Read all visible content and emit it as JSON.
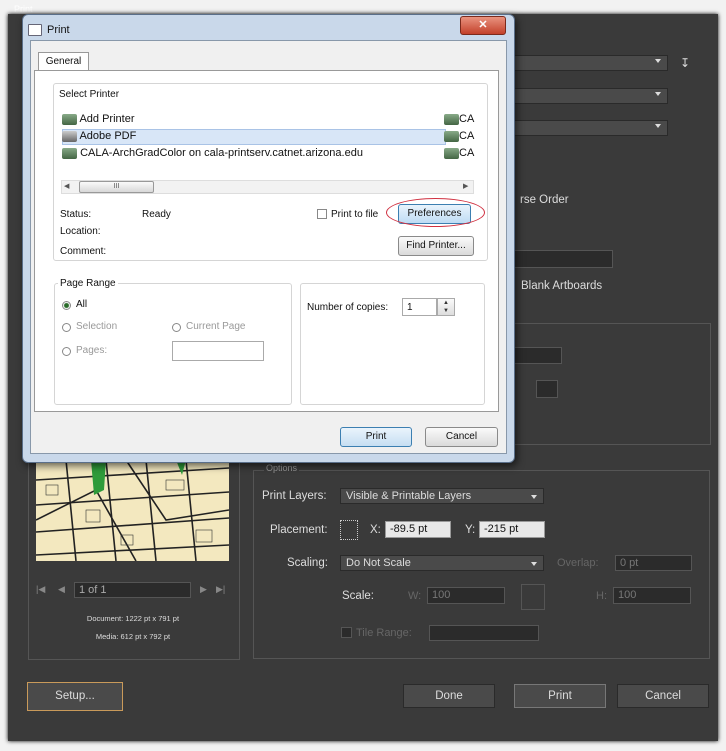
{
  "window": {
    "title": "Print"
  },
  "bg_dialog": {
    "title": "Print",
    "export_icon": "download-icon",
    "reverse_order_fragment": "rse Order",
    "blank_artboards_fragment": "Blank Artboards",
    "preview_nav": {
      "page_field": "1 of 1"
    },
    "doc_info": {
      "document": "Document: 1222 pt x 791 pt",
      "media": "Media: 612 pt x 792 pt"
    },
    "options": {
      "heading": "Options",
      "print_layers_label": "Print Layers:",
      "print_layers_value": "Visible & Printable Layers",
      "placement_label": "Placement:",
      "x_label": "X:",
      "x_value": "-89.5 pt",
      "y_label": "Y:",
      "y_value": "-215 pt",
      "scaling_label": "Scaling:",
      "scaling_value": "Do Not Scale",
      "overlap_label": "Overlap:",
      "overlap_value": "0 pt",
      "scale_label": "Scale:",
      "w_label": "W:",
      "w_value": "100",
      "h_label": "H:",
      "h_value": "100",
      "tile_range_label": "Tile Range:"
    },
    "buttons": {
      "setup": "Setup...",
      "done": "Done",
      "print": "Print",
      "cancel": "Cancel"
    }
  },
  "print_dialog": {
    "title": "Print",
    "tabs": [
      "General"
    ],
    "select_printer": {
      "label": "Select Printer",
      "printers": [
        "Add Printer",
        "Adobe PDF",
        "CALA-ArchGradColor on cala-printserv.catnet.arizona.edu"
      ],
      "right_col": [
        "CA",
        "CA",
        "CA"
      ],
      "selected_index": 1,
      "scroll_thumb_text": "III"
    },
    "status": {
      "status_label": "Status:",
      "status_value": "Ready",
      "location_label": "Location:",
      "comment_label": "Comment:",
      "print_to_file": "Print to file",
      "preferences": "Preferences",
      "find_printer": "Find Printer..."
    },
    "page_range": {
      "label": "Page Range",
      "all": "All",
      "selection": "Selection",
      "current_page": "Current Page",
      "pages": "Pages:"
    },
    "copies": {
      "label": "Number of copies:",
      "value": "1"
    },
    "buttons": {
      "print": "Print",
      "cancel": "Cancel"
    }
  },
  "colors": {
    "annotation_circle": "#d03040",
    "dialog_bg": "#3a3a3a"
  }
}
